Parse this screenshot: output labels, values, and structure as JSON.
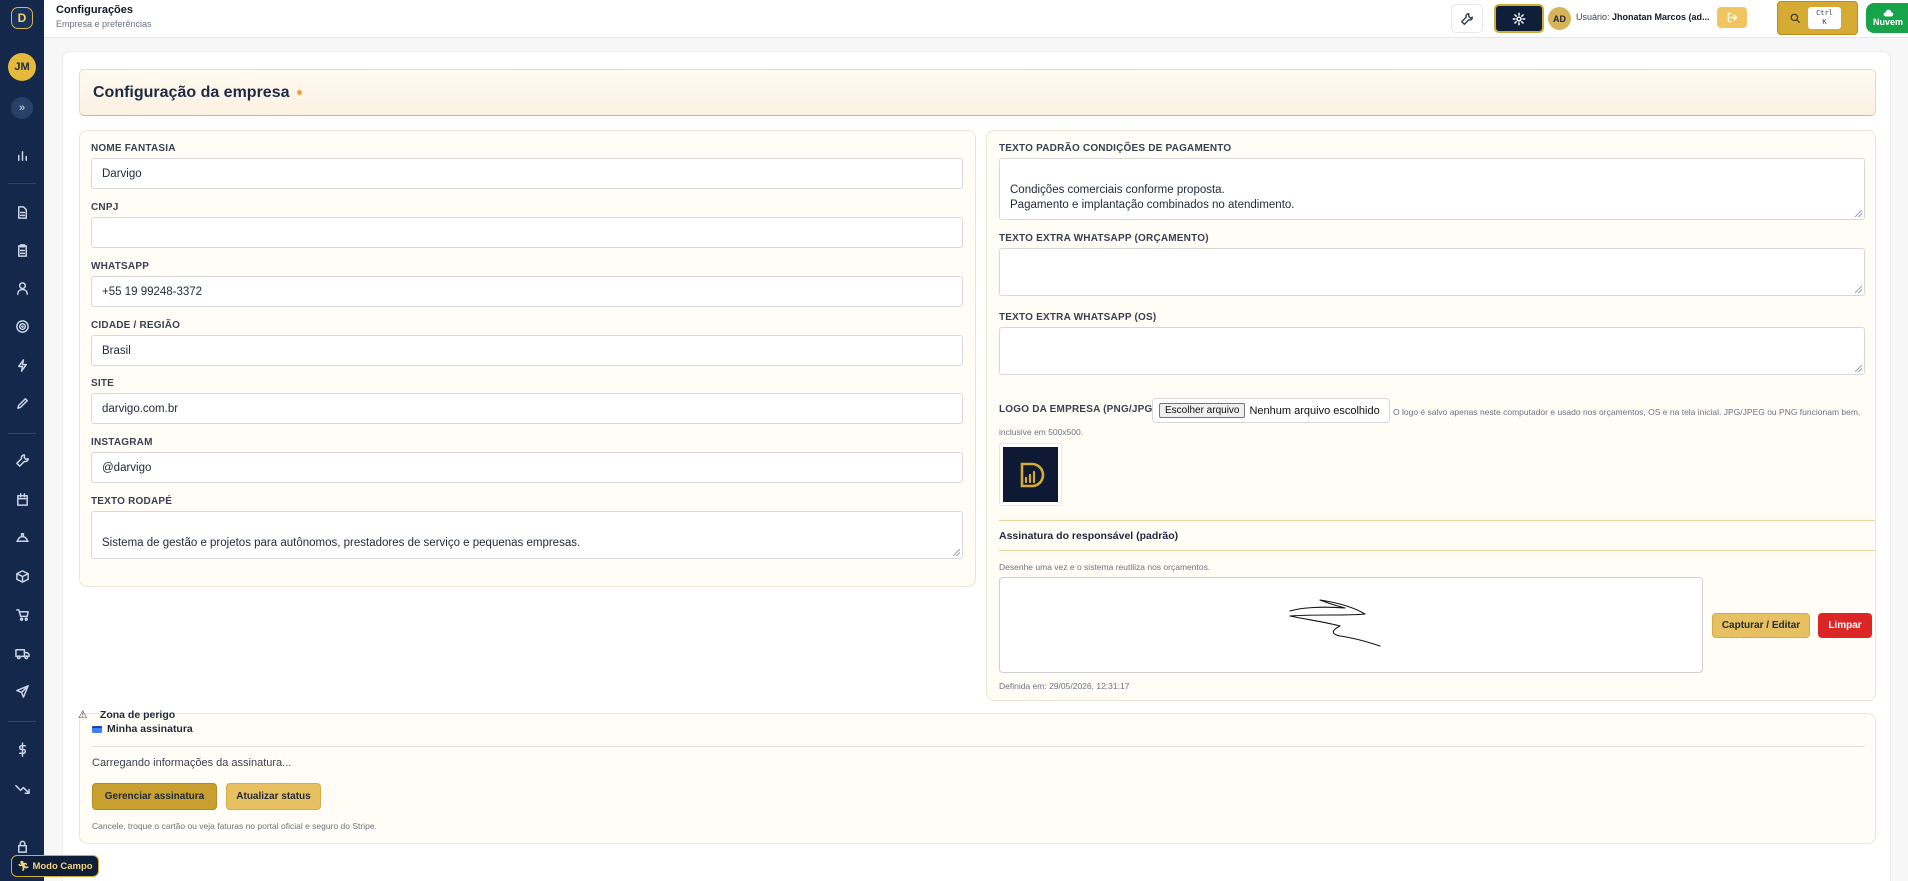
{
  "app": {
    "logo_letter": "D",
    "user_initials": "JM",
    "expand_glyph": "»"
  },
  "header": {
    "title": "Configurações",
    "subtitle": "Empresa e preferências",
    "user_avatar": "AD",
    "user_label": "Usuário:",
    "user_name": "Jhonatan Marcos (ad...",
    "kbd_line1": "Ctrl",
    "kbd_line2": "K",
    "cloud_label": "Nuvem"
  },
  "page": {
    "title": "Configuração da empresa"
  },
  "company": {
    "fantasy_name_label": "NOME FANTASIA",
    "fantasy_name": "Darvigo",
    "cnpj_label": "CNPJ",
    "cnpj": "",
    "whatsapp_label": "WHATSAPP",
    "whatsapp": "+55 19 99248-3372",
    "city_label": "CIDADE / REGIÃO",
    "city": "Brasil",
    "site_label": "SITE",
    "site": "darvigo.com.br",
    "instagram_label": "INSTAGRAM",
    "instagram": "@darvigo",
    "footer_label": "TEXTO RODAPÉ",
    "footer_text": "Sistema de gestão e projetos para autônomos, prestadores de serviço e pequenas empresas."
  },
  "texts": {
    "payment_label": "TEXTO PADRÃO CONDIÇÕES DE PAGAMENTO",
    "payment_text": "Condições comerciais conforme proposta.\nPagamento e implantação combinados no atendimento.",
    "wa_budget_label": "TEXTO EXTRA WHATSAPP (ORÇAMENTO)",
    "wa_budget_text": "",
    "wa_os_label": "TEXTO EXTRA WHATSAPP (OS)",
    "wa_os_text": "",
    "logo_label": "LOGO DA EMPRESA (PNG/JPG)",
    "file_button": "Escolher arquivo",
    "file_none": "Nenhum arquivo escolhido",
    "logo_hint": "O logo é salvo apenas neste computador e usado nos orçamentos, OS e na tela inicial. JPG/JPEG ou PNG funcionam bem, inclusive em 500x500."
  },
  "signature": {
    "title": "Assinatura do responsável (padrão)",
    "hint": "Desenhe uma vez e o sistema reutiliza nos orçamentos.",
    "capture_button": "Capturar / Editar",
    "clear_button": "Limpar",
    "defined_at": "Definida em: 29/05/2026, 12:31:17"
  },
  "subscription": {
    "title": "Minha assinatura",
    "loading": "Carregando informações da assinatura...",
    "manage_button": "Gerenciar assinatura",
    "refresh_button": "Atualizar status",
    "note": "Cancele, troque o cartão ou veja faturas no portal oficial e seguro do Stripe."
  },
  "field_mode": {
    "label": "Modo Campo"
  },
  "danger_zone": {
    "title": "Zona de perigo"
  },
  "colors": {
    "sidebar": "#13284a",
    "accent": "#d6ab34",
    "danger": "#dc2626",
    "success": "#16a34a"
  }
}
